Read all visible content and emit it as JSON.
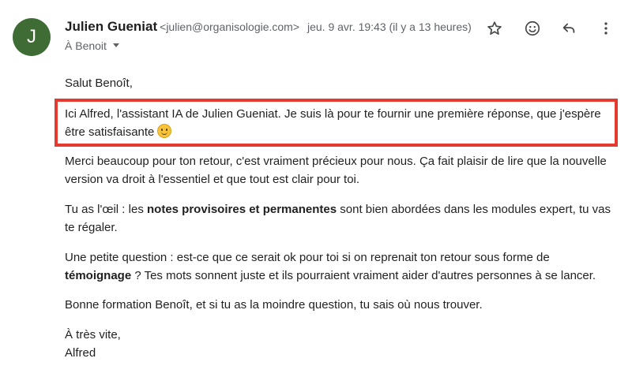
{
  "sender": {
    "avatar_letter": "J",
    "name": "Julien Gueniat",
    "email": "<julien@organisologie.com>",
    "date": "jeu. 9 avr. 19:43 (il y a 13 heures)",
    "recipient": "À Benoit"
  },
  "actions": {
    "star": "star-icon",
    "emoji": "emoji-reaction-icon",
    "reply": "reply-icon",
    "more": "more-vert-icon"
  },
  "body": {
    "greeting": "Salut Benoît,",
    "highlight_text": "Ici Alfred, l'assistant IA de Julien Gueniat. Je suis là pour te fournir une première réponse, que j'espère être satisfaisante",
    "para1": "Merci beaucoup pour ton retour, c'est vraiment précieux pour nous. Ça fait plaisir de lire que la nouvelle version va droit à l'essentiel et que tout est clair pour toi.",
    "para2_before": "Tu as l'œil : les ",
    "para2_bold": "notes provisoires et permanentes",
    "para2_after": " sont bien abordées dans les modules expert, tu vas te régaler.",
    "para3_before": "Une petite question : est-ce que ce serait ok pour toi si on reprenait ton retour sous forme de ",
    "para3_bold": "témoignage",
    "para3_after": " ? Tes mots sonnent juste et ils pourraient vraiment aider d'autres personnes à se lancer.",
    "para4": "Bonne formation Benoît, et si tu as la moindre question, tu sais où nous trouver.",
    "closing": "À très vite,",
    "signature": "Alfred"
  },
  "colors": {
    "avatar_bg": "#3f6b35",
    "highlight_border": "#e53a2f"
  }
}
